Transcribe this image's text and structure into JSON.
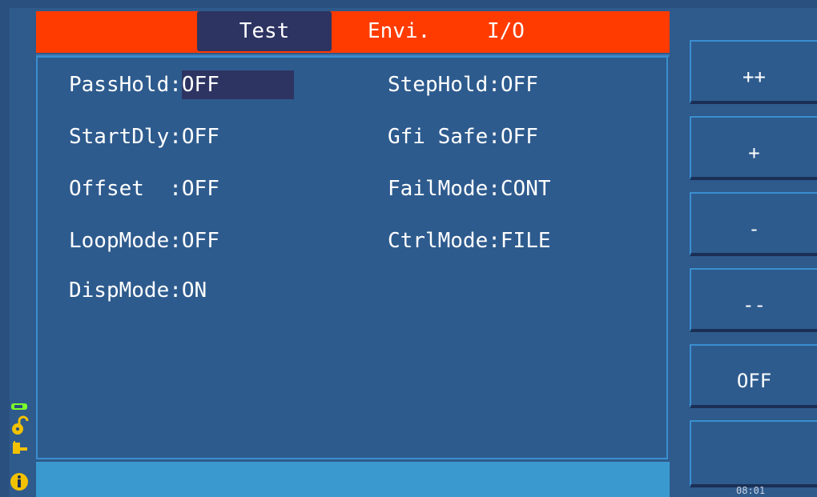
{
  "tabs": [
    {
      "label": "Test",
      "active": true
    },
    {
      "label": "Envi.",
      "active": false
    },
    {
      "label": "I/O",
      "active": false
    }
  ],
  "settings": {
    "left": [
      {
        "label": "PassHold",
        "sep": ":",
        "value": "OFF"
      },
      {
        "label": "StartDly",
        "sep": ":",
        "value": "OFF"
      },
      {
        "label": "Offset  ",
        "sep": ":",
        "value": "OFF"
      },
      {
        "label": "LoopMode",
        "sep": ":",
        "value": "OFF"
      },
      {
        "label": "DispMode",
        "sep": ":",
        "value": "ON"
      }
    ],
    "right": [
      {
        "label": "StepHold",
        "sep": ":",
        "value": "OFF"
      },
      {
        "label": "Gfi Safe",
        "sep": ":",
        "value": "OFF"
      },
      {
        "label": "FailMode",
        "sep": ":",
        "value": "CONT"
      },
      {
        "label": "CtrlMode",
        "sep": ":",
        "value": "FILE"
      }
    ]
  },
  "softkeys": [
    "++",
    "+",
    "-",
    "--",
    "OFF",
    ""
  ],
  "clock": "08:01",
  "icons": [
    "usb-icon",
    "unlock-icon",
    "plug-icon",
    "info-icon"
  ],
  "colors": {
    "tab_bar": "#ff3b00",
    "active_tab": "#2d3462",
    "background": "#2f5a8c",
    "status_bar": "#3a9ad0"
  }
}
